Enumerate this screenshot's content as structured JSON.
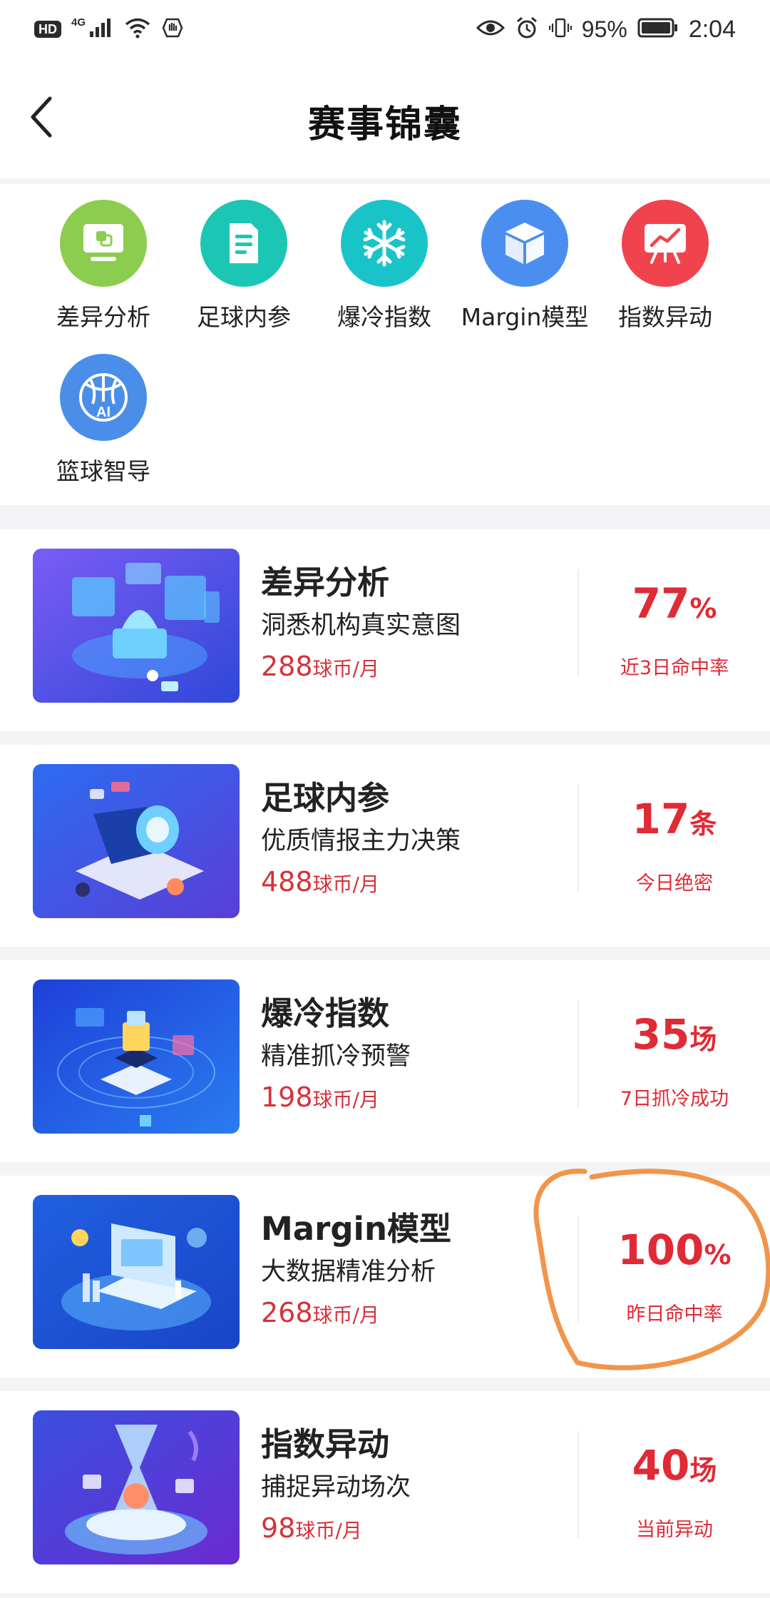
{
  "status_bar": {
    "hd": "HD",
    "network": "4G",
    "battery": "95%",
    "time": "2:04"
  },
  "nav": {
    "title": "赛事锦囊"
  },
  "categories": [
    {
      "label": "差异分析",
      "icon": "monitor-icon",
      "color": "#8ccc4e"
    },
    {
      "label": "足球内参",
      "icon": "document-icon",
      "color": "#1cc6b4"
    },
    {
      "label": "爆冷指数",
      "icon": "snowflake-icon",
      "color": "#19c4c9"
    },
    {
      "label": "Margin模型",
      "icon": "cube-icon",
      "color": "#4a8ff0"
    },
    {
      "label": "指数异动",
      "icon": "trend-board-icon",
      "color": "#f0434e"
    },
    {
      "label": "篮球智导",
      "icon": "basketball-ai-icon",
      "color": "#4a8ee9"
    }
  ],
  "cards": [
    {
      "title": "差异分析",
      "subtitle": "洞悉机构真实意图",
      "price": "288",
      "price_unit": "球币/月",
      "stat_value": "77",
      "stat_unit": "%",
      "stat_label": "近3日命中率"
    },
    {
      "title": "足球内参",
      "subtitle": "优质情报主力决策",
      "price": "488",
      "price_unit": "球币/月",
      "stat_value": "17",
      "stat_unit": "条",
      "stat_label": "今日绝密"
    },
    {
      "title": "爆冷指数",
      "subtitle": "精准抓冷预警",
      "price": "198",
      "price_unit": "球币/月",
      "stat_value": "35",
      "stat_unit": "场",
      "stat_label": "7日抓冷成功"
    },
    {
      "title": "Margin模型",
      "subtitle": "大数据精准分析",
      "price": "268",
      "price_unit": "球币/月",
      "stat_value": "100",
      "stat_unit": "%",
      "stat_label": "昨日命中率"
    },
    {
      "title": "指数异动",
      "subtitle": "捕捉异动场次",
      "price": "98",
      "price_unit": "球币/月",
      "stat_value": "40",
      "stat_unit": "场",
      "stat_label": "当前异动"
    }
  ],
  "colors": {
    "accent_red": "#e02a35",
    "price_red": "#d6323b",
    "annotation_orange": "#f0954a"
  }
}
